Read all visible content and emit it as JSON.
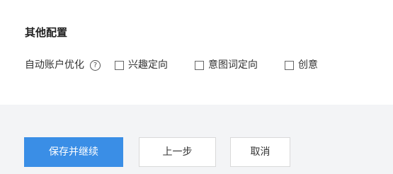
{
  "section": {
    "title": "其他配置"
  },
  "auto_optimize": {
    "label": "自动账户优化",
    "help_glyph": "?",
    "help_icon": "question-circle-icon",
    "options": [
      {
        "label": "兴趣定向",
        "checked": false
      },
      {
        "label": "意图词定向",
        "checked": false
      },
      {
        "label": "创意",
        "checked": false
      }
    ]
  },
  "actions": {
    "save_continue": "保存并继续",
    "prev_step": "上一步",
    "cancel": "取消"
  },
  "colors": {
    "primary": "#3a8ee6",
    "background": "#f3f4f6",
    "panel": "#ffffff",
    "border": "#d9d9d9"
  }
}
